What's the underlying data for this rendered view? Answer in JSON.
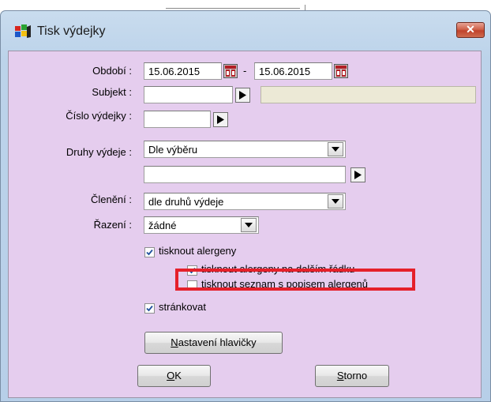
{
  "window": {
    "title": "Tisk výdejky",
    "close_label": "✕"
  },
  "form": {
    "obdobi": {
      "label": "Období :",
      "date_from": "15.06.2015",
      "separator": "-",
      "date_to": "15.06.2015"
    },
    "subjekt": {
      "label": "Subjekt :",
      "value": ""
    },
    "cislo_vydejky": {
      "label": "Číslo výdejky :",
      "value": ""
    },
    "druhy_vydeje": {
      "label": "Druhy výdeje :",
      "selected": "Dle výběru",
      "extra_value": ""
    },
    "cleneni": {
      "label": "Členění :",
      "selected": "dle druhů výdeje"
    },
    "razeni": {
      "label": "Řazení :",
      "selected": "žádné"
    }
  },
  "options": [
    {
      "label": "tisknout alergeny",
      "checked": true
    },
    {
      "label": "tisknout alergeny na dalším řádku",
      "checked": true
    },
    {
      "label": "tisknout seznam s popisem alergenů",
      "checked": false
    },
    {
      "label": "stránkovat",
      "checked": true
    }
  ],
  "buttons": {
    "header_settings": {
      "accel": "N",
      "rest": "astavení hlavičky"
    },
    "ok": {
      "accel": "O",
      "rest": "K"
    },
    "cancel": {
      "accel": "S",
      "rest": "torno"
    }
  },
  "colors": {
    "client_bg": "#e5cdee",
    "highlight": "#e5202a",
    "frame": "#b7cfe8"
  }
}
